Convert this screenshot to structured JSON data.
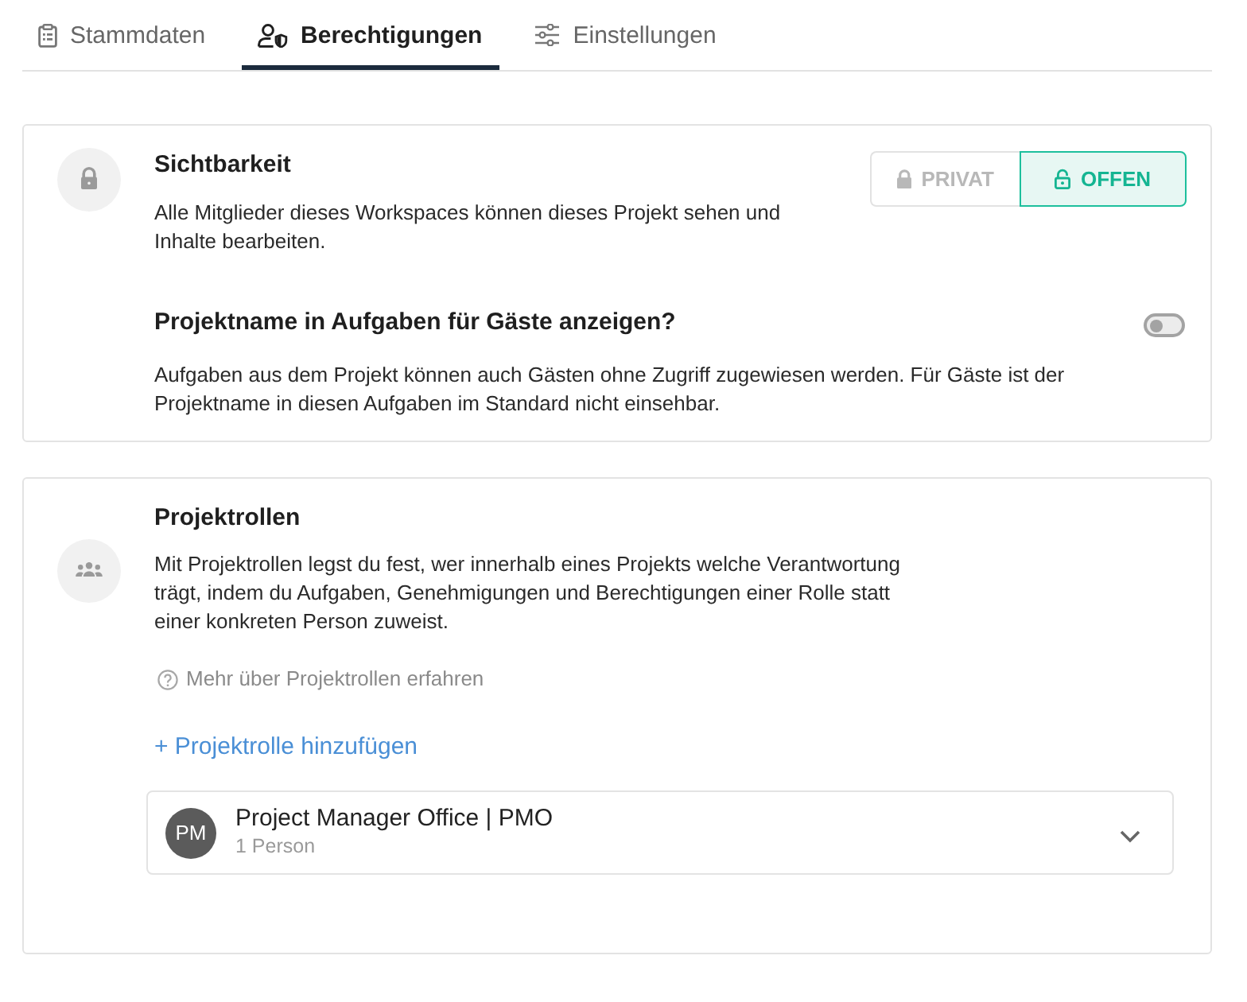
{
  "tabs": [
    {
      "label": "Stammdaten",
      "selected": false
    },
    {
      "label": "Berechtigungen",
      "selected": true
    },
    {
      "label": "Einstellungen",
      "selected": false
    }
  ],
  "visibility": {
    "title": "Sichtbarkeit",
    "description": "Alle Mitglieder dieses Workspaces können dieses Projekt sehen und Inhalte bearbeiten.",
    "options": [
      {
        "label": "PRIVAT",
        "selected": false
      },
      {
        "label": "OFFEN",
        "selected": true
      }
    ]
  },
  "guest_project_name": {
    "title": "Projektname in Aufgaben für Gäste anzeigen?",
    "description": "Aufgaben aus dem Projekt können auch Gästen ohne Zugriff zugewiesen werden. Für Gäste ist der Projektname in diesen Aufgaben im Standard nicht einsehbar.",
    "on": false
  },
  "project_roles": {
    "title": "Projektrollen",
    "description": "Mit Projektrollen legst du fest, wer innerhalb eines Projekts welche Verantwortung trägt, indem du Aufgaben, Genehmigungen und Berechtigungen einer Rolle statt einer konkreten Person zuweist.",
    "help_link": "Mehr über Projektrollen erfahren",
    "add_link": "+ Projektrolle hinzufügen",
    "roles": [
      {
        "initials": "PM",
        "name": "Project Manager Office | PMO",
        "count": "1 Person",
        "expanded": false
      }
    ]
  }
}
